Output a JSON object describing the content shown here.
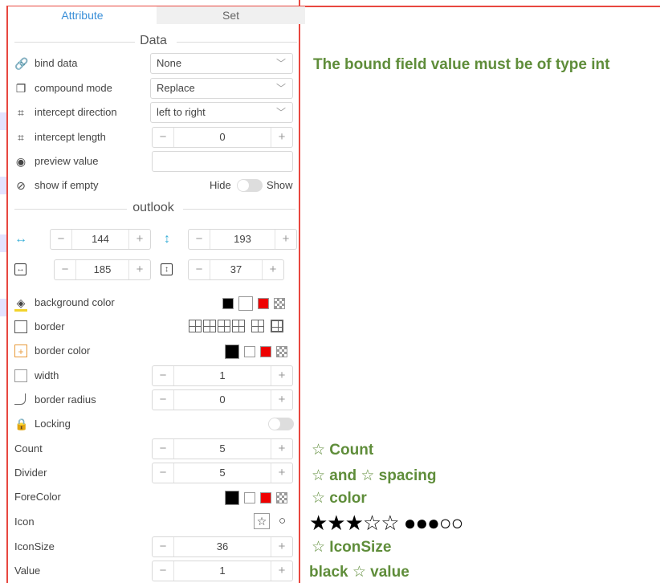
{
  "tabs": {
    "attribute": "Attribute",
    "set": "Set"
  },
  "sections": {
    "data": "Data",
    "outlook": "outlook"
  },
  "rows": {
    "bind_data": {
      "label": "bind data",
      "value": "None"
    },
    "compound_mode": {
      "label": "compound mode",
      "value": "Replace"
    },
    "intercept_direction": {
      "label": "intercept direction",
      "value": "left to right"
    },
    "intercept_length": {
      "label": "intercept length",
      "value": "0"
    },
    "preview_value": {
      "label": "preview value",
      "value": ""
    },
    "show_if_empty": {
      "label": "show if empty",
      "hide": "Hide",
      "show": "Show"
    },
    "width_x": {
      "value": "144"
    },
    "height_y": {
      "value": "193"
    },
    "size_w": {
      "value": "185"
    },
    "size_h": {
      "value": "37"
    },
    "background_color": {
      "label": "background color"
    },
    "border": {
      "label": "border"
    },
    "border_color": {
      "label": "border color"
    },
    "width": {
      "label": "width",
      "value": "1"
    },
    "border_radius": {
      "label": "border radius",
      "value": "0"
    },
    "locking": {
      "label": "Locking"
    },
    "count": {
      "label": "Count",
      "value": "5"
    },
    "divider": {
      "label": "Divider",
      "value": "5"
    },
    "forecolor": {
      "label": "ForeColor"
    },
    "icon": {
      "label": "Icon"
    },
    "iconsize": {
      "label": "IconSize",
      "value": "36"
    },
    "value": {
      "label": "Value",
      "value": "1"
    }
  },
  "notes": {
    "bound_field": "The bound field value must be of type int",
    "count": "☆ Count",
    "spacing": "☆ and ☆ spacing",
    "color": "☆  color",
    "icons_demo": "★★★☆☆ ●●●○○",
    "iconsize": "☆ IconSize",
    "value": "black  ☆ value"
  },
  "stepper": {
    "minus": "−",
    "plus": "+"
  },
  "colors": {
    "accent": "#3a8fd8",
    "note": "#5f8d3a",
    "frame": "#e8473f"
  }
}
